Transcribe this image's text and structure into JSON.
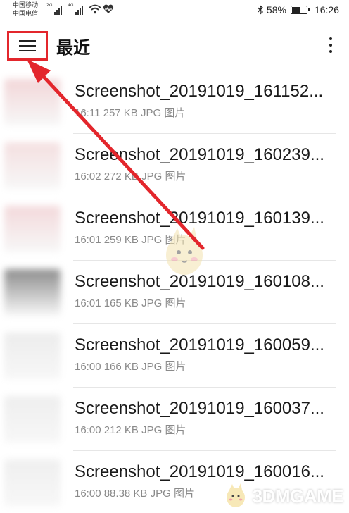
{
  "status_bar": {
    "carrier_1": "中国移动",
    "carrier_2": "中国电信",
    "sim1_network": "2G",
    "sim2_network": "4G",
    "battery_percent": "58%",
    "battery_level": 0.58,
    "time": "16:26",
    "icons": [
      "signal-icon",
      "wifi-icon",
      "health-icon",
      "bluetooth-icon",
      "battery-icon"
    ]
  },
  "toolbar": {
    "title": "最近",
    "menu_icon": "hamburger-menu-icon",
    "overflow_icon": "more-vertical-icon"
  },
  "files": [
    {
      "name": "Screenshot_20191019_161152...",
      "time": "16:11",
      "size": "257 KB",
      "type": "JPG",
      "category": "图片"
    },
    {
      "name": "Screenshot_20191019_160239...",
      "time": "16:02",
      "size": "272 KB",
      "type": "JPG",
      "category": "图片"
    },
    {
      "name": "Screenshot_20191019_160139...",
      "time": "16:01",
      "size": "259 KB",
      "type": "JPG",
      "category": "图片"
    },
    {
      "name": "Screenshot_20191019_160108...",
      "time": "16:01",
      "size": "165 KB",
      "type": "JPG",
      "category": "图片"
    },
    {
      "name": "Screenshot_20191019_160059...",
      "time": "16:00",
      "size": "166 KB",
      "type": "JPG",
      "category": "图片"
    },
    {
      "name": "Screenshot_20191019_160037...",
      "time": "16:00",
      "size": "212 KB",
      "type": "JPG",
      "category": "图片"
    },
    {
      "name": "Screenshot_20191019_160016...",
      "time": "16:00",
      "size": "88.38 KB",
      "type": "JPG",
      "category": "图片"
    }
  ],
  "watermark": {
    "text": "3DMGAME"
  },
  "colors": {
    "annotation_red": "#e3262c",
    "meta_gray": "#8a8a8a",
    "text_dark": "#1a1a1a"
  }
}
